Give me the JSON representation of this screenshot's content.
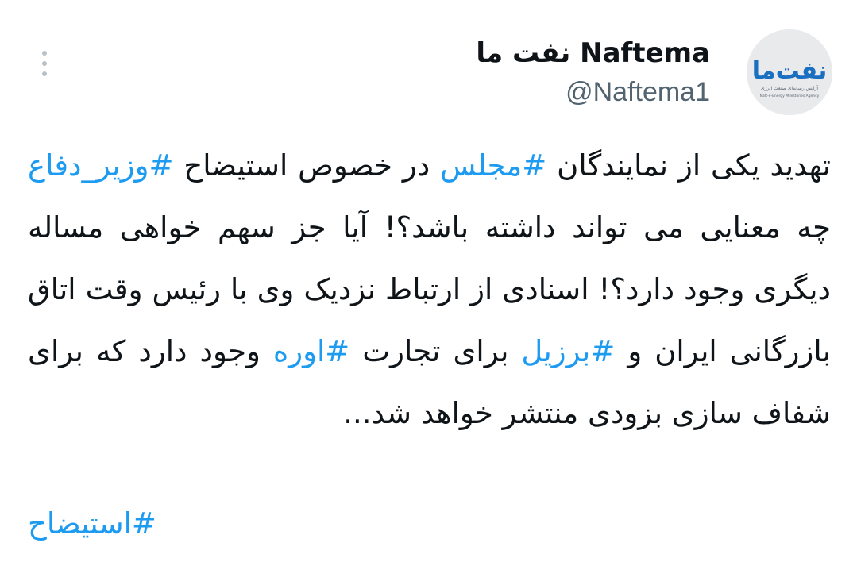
{
  "author": {
    "display_name": "نفت ما Naftema",
    "handle": "@Naftema1",
    "avatar_logo_text": "نفت‌ما",
    "avatar_tagline": "آژانس رسانه‌ای صنعت انرژی",
    "avatar_tagline_en": "Naft-e-Energy Milestones Agency"
  },
  "more_button": {
    "icon": "more-vertical-icon"
  },
  "tweet": {
    "segments": [
      {
        "text": "تهدید یکی از نمایندگان ",
        "hashtag": false
      },
      {
        "text": "#مجلس",
        "hashtag": true
      },
      {
        "text": " در خصوص استیضاح ",
        "hashtag": false
      },
      {
        "text": "#وزیر_دفاع",
        "hashtag": true
      },
      {
        "text": " چه معنایی می تواند داشته باشد؟! آیا جز سهم خواهی مساله دیگری وجود دارد؟! اسنادی از ارتباط نزدیک وی با رئیس وقت اتاق بازرگانی ایران و ",
        "hashtag": false
      },
      {
        "text": "#برزیل",
        "hashtag": true
      },
      {
        "text": " برای تجارت ",
        "hashtag": false
      },
      {
        "text": "#اوره",
        "hashtag": true
      },
      {
        "text": " وجود دارد که برای شفاف سازی بزودی منتشر خواهد شد...",
        "hashtag": false
      }
    ],
    "trailing_hashtag": "#استیضاح"
  },
  "colors": {
    "hashtag": "#1d9bf0",
    "text": "#0f1419",
    "secondary": "#536471",
    "logo_blue": "#1a6fc0"
  }
}
